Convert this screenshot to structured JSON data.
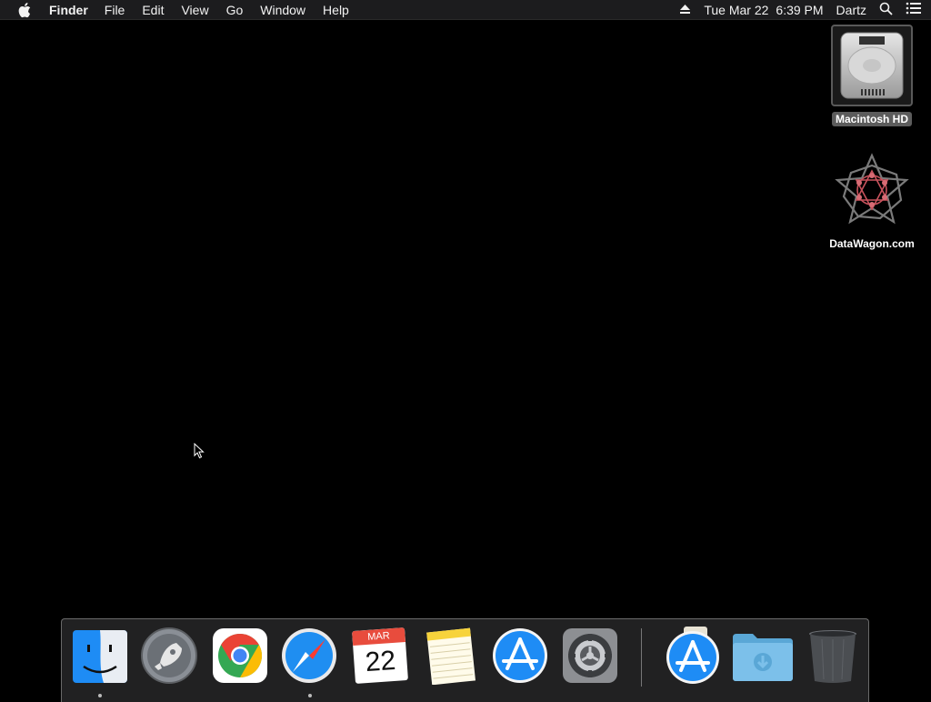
{
  "menubar": {
    "app_name": "Finder",
    "menus": [
      "File",
      "Edit",
      "View",
      "Go",
      "Window",
      "Help"
    ],
    "clock_day": "Tue Mar 22",
    "clock_time": "6:39 PM",
    "user": "Dartz"
  },
  "desktop": {
    "icons": [
      {
        "label": "Macintosh HD",
        "icon": "hard-drive-icon"
      },
      {
        "label": "DataWagon.com",
        "icon": "star-logo-icon"
      }
    ]
  },
  "dock": {
    "items": [
      {
        "name": "finder",
        "icon": "finder-icon",
        "running": true
      },
      {
        "name": "launchpad",
        "icon": "rocket-icon",
        "running": false
      },
      {
        "name": "chrome",
        "icon": "chrome-icon",
        "running": false
      },
      {
        "name": "safari",
        "icon": "compass-icon",
        "running": true
      },
      {
        "name": "calendar",
        "icon": "calendar-icon",
        "running": false,
        "month": "MAR",
        "day": "22"
      },
      {
        "name": "notes",
        "icon": "notepad-icon",
        "running": false
      },
      {
        "name": "app-store",
        "icon": "app-store-icon",
        "running": false
      },
      {
        "name": "system-preferences",
        "icon": "gear-icon",
        "running": false
      },
      {
        "name": "app-store-installer",
        "icon": "app-store-icon",
        "running": false
      },
      {
        "name": "downloads",
        "icon": "download-folder-icon",
        "running": false
      },
      {
        "name": "trash",
        "icon": "trash-icon",
        "running": false
      }
    ]
  },
  "colors": {
    "menubar_bg": "#1c1c1e",
    "desktop_bg": "#000000",
    "accent_blue": "#1e8cf5"
  }
}
